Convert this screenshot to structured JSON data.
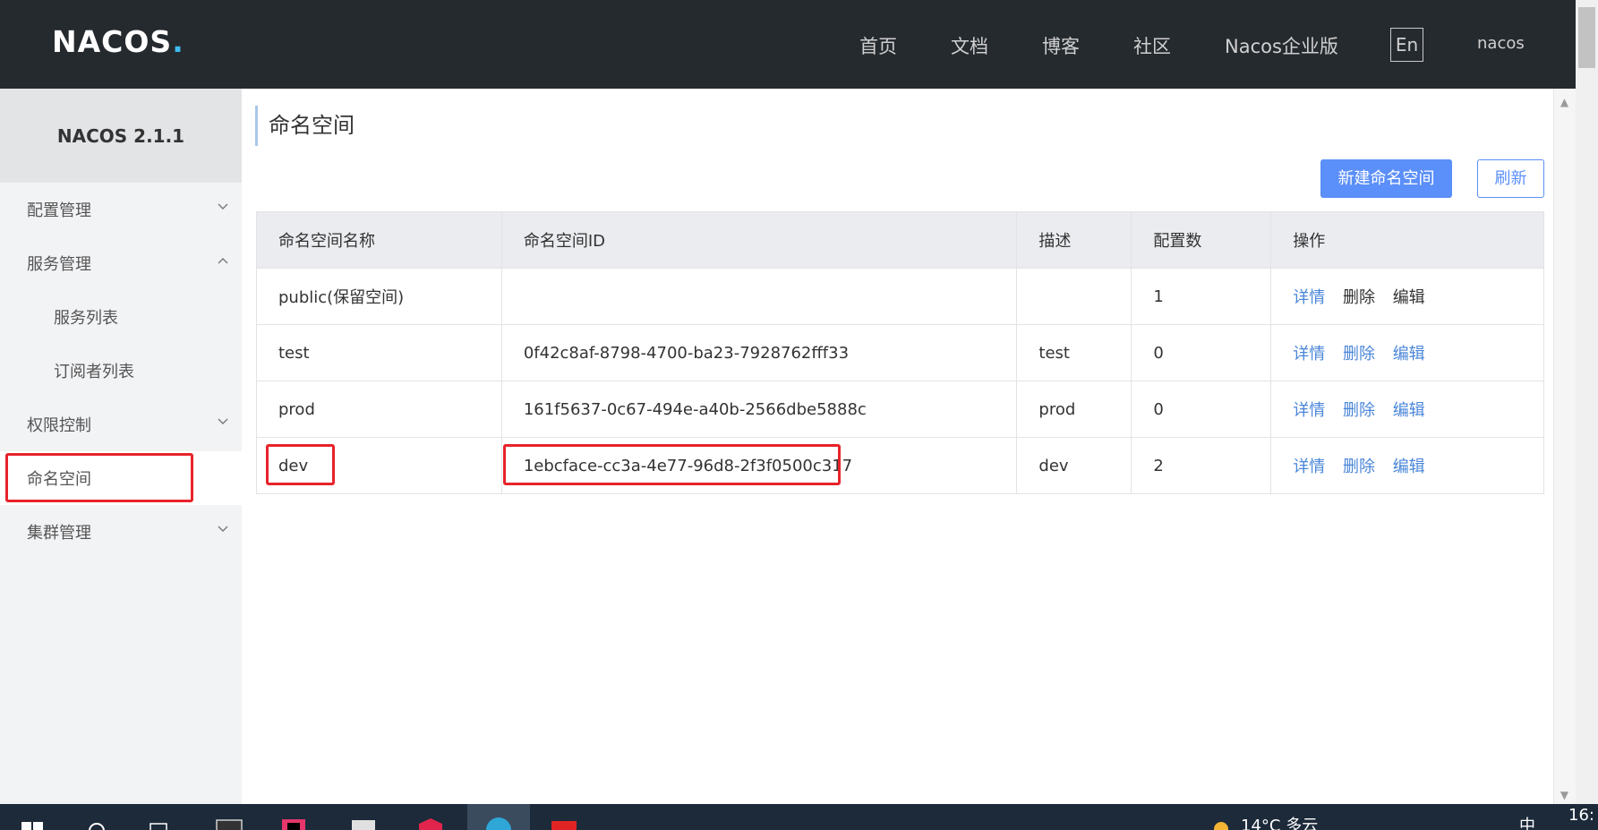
{
  "topnav": {
    "logo": "NACOS",
    "items": [
      "首页",
      "文档",
      "博客",
      "社区",
      "Nacos企业版"
    ],
    "lang": "En",
    "user": "nacos"
  },
  "sidebar": {
    "version": "NACOS 2.1.1",
    "items": [
      {
        "label": "配置管理",
        "chevron": "down"
      },
      {
        "label": "服务管理",
        "chevron": "up"
      },
      {
        "label": "服务列表"
      },
      {
        "label": "订阅者列表"
      },
      {
        "label": "权限控制",
        "chevron": "down"
      },
      {
        "label": "命名空间",
        "active": true
      },
      {
        "label": "集群管理",
        "chevron": "down"
      }
    ]
  },
  "main": {
    "title": "命名空间",
    "create_button": "新建命名空间",
    "refresh_button": "刷新",
    "table": {
      "headers": [
        "命名空间名称",
        "命名空间ID",
        "描述",
        "配置数",
        "操作"
      ],
      "rows": [
        {
          "name": "public(保留空间)",
          "id": "",
          "desc": "",
          "count": "1",
          "ops": [
            "详情",
            "删除",
            "编辑"
          ]
        },
        {
          "name": "test",
          "id": "0f42c8af-8798-4700-ba23-7928762fff33",
          "desc": "test",
          "count": "0",
          "ops": [
            "详情",
            "删除",
            "编辑"
          ]
        },
        {
          "name": "prod",
          "id": "161f5637-0c67-494e-a40b-2566dbe5888c",
          "desc": "prod",
          "count": "0",
          "ops": [
            "详情",
            "删除",
            "编辑"
          ]
        },
        {
          "name": "dev",
          "id": "1ebcface-cc3a-4e77-96d8-2f3f0500c317",
          "desc": "dev",
          "count": "2",
          "ops": [
            "详情",
            "删除",
            "编辑"
          ]
        }
      ]
    }
  },
  "colors": {
    "topbar": "#252a2f",
    "accent": "#5b8ff9",
    "highlight": "#e8232a",
    "link": "#4a86d8"
  },
  "taskbar": {
    "weather": "14°C 多云",
    "clock": "16:",
    "ime": "中"
  }
}
